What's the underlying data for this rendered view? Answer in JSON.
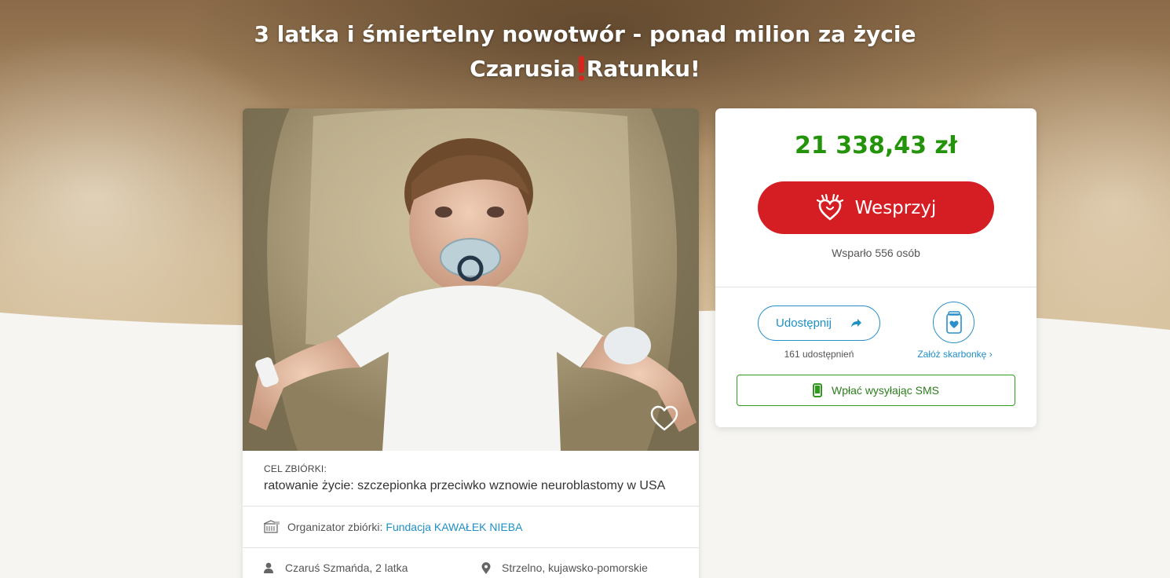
{
  "page": {
    "title_line1": "3 latka i śmiertelny nowotwór - ponad milion za życie",
    "title_line2_a": "Czarusia",
    "title_line2_b": "Ratunku!"
  },
  "fundraiser": {
    "goal_label": "CEL ZBIÓRKI:",
    "goal_text": "ratowanie życie: szczepionka przeciwko wznowie neuroblastomy w USA",
    "organizer_label": "Organizator zbiórki:",
    "organizer_name": "Fundacja KAWAŁEK NIEBA",
    "beneficiary": "Czaruś Szmańda, 2 latka",
    "location": "Strzelno, kujawsko-pomorskie"
  },
  "donation": {
    "amount": "21 338,43 zł",
    "donate_label": "Wesprzyj",
    "supporters": "Wsparło 556 osób",
    "share_label": "Udostępnij",
    "share_count": "161 udostępnień",
    "piggy_label": "Załóż skarbonkę ›",
    "sms_label": "Wpłać wysyłając SMS"
  },
  "colors": {
    "amount": "#23940a",
    "donate": "#d41e24",
    "link": "#1f8fc4",
    "sms": "#2f9a1d"
  },
  "icons": [
    "heart-hand-icon",
    "share-arrow-icon",
    "piggy-jar-icon",
    "phone-icon",
    "favorite-heart-icon",
    "organizer-icon",
    "person-icon",
    "location-pin-icon"
  ]
}
